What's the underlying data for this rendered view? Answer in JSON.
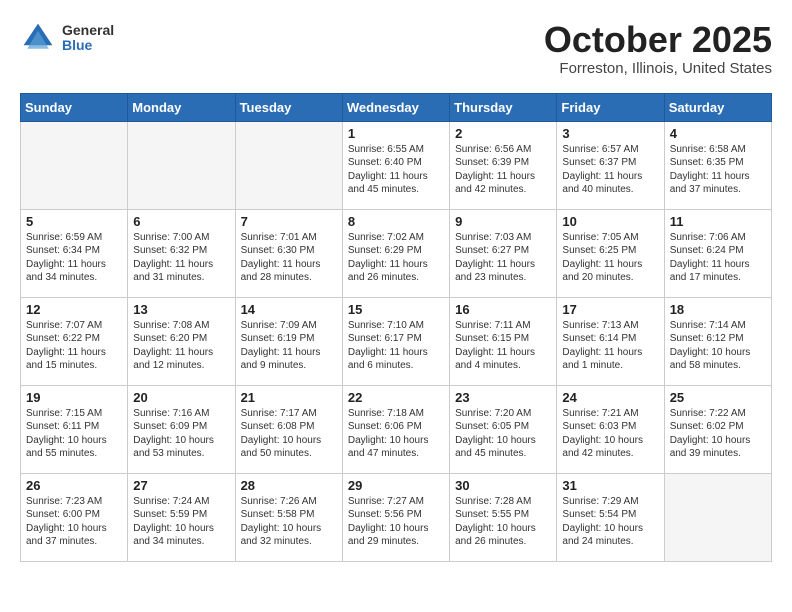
{
  "logo": {
    "general": "General",
    "blue": "Blue"
  },
  "title": "October 2025",
  "location": "Forreston, Illinois, United States",
  "weekdays": [
    "Sunday",
    "Monday",
    "Tuesday",
    "Wednesday",
    "Thursday",
    "Friday",
    "Saturday"
  ],
  "weeks": [
    [
      {
        "day": null
      },
      {
        "day": null
      },
      {
        "day": null
      },
      {
        "day": "1",
        "sunrise": "6:55 AM",
        "sunset": "6:40 PM",
        "daylight": "11 hours and 45 minutes."
      },
      {
        "day": "2",
        "sunrise": "6:56 AM",
        "sunset": "6:39 PM",
        "daylight": "11 hours and 42 minutes."
      },
      {
        "day": "3",
        "sunrise": "6:57 AM",
        "sunset": "6:37 PM",
        "daylight": "11 hours and 40 minutes."
      },
      {
        "day": "4",
        "sunrise": "6:58 AM",
        "sunset": "6:35 PM",
        "daylight": "11 hours and 37 minutes."
      }
    ],
    [
      {
        "day": "5",
        "sunrise": "6:59 AM",
        "sunset": "6:34 PM",
        "daylight": "11 hours and 34 minutes."
      },
      {
        "day": "6",
        "sunrise": "7:00 AM",
        "sunset": "6:32 PM",
        "daylight": "11 hours and 31 minutes."
      },
      {
        "day": "7",
        "sunrise": "7:01 AM",
        "sunset": "6:30 PM",
        "daylight": "11 hours and 28 minutes."
      },
      {
        "day": "8",
        "sunrise": "7:02 AM",
        "sunset": "6:29 PM",
        "daylight": "11 hours and 26 minutes."
      },
      {
        "day": "9",
        "sunrise": "7:03 AM",
        "sunset": "6:27 PM",
        "daylight": "11 hours and 23 minutes."
      },
      {
        "day": "10",
        "sunrise": "7:05 AM",
        "sunset": "6:25 PM",
        "daylight": "11 hours and 20 minutes."
      },
      {
        "day": "11",
        "sunrise": "7:06 AM",
        "sunset": "6:24 PM",
        "daylight": "11 hours and 17 minutes."
      }
    ],
    [
      {
        "day": "12",
        "sunrise": "7:07 AM",
        "sunset": "6:22 PM",
        "daylight": "11 hours and 15 minutes."
      },
      {
        "day": "13",
        "sunrise": "7:08 AM",
        "sunset": "6:20 PM",
        "daylight": "11 hours and 12 minutes."
      },
      {
        "day": "14",
        "sunrise": "7:09 AM",
        "sunset": "6:19 PM",
        "daylight": "11 hours and 9 minutes."
      },
      {
        "day": "15",
        "sunrise": "7:10 AM",
        "sunset": "6:17 PM",
        "daylight": "11 hours and 6 minutes."
      },
      {
        "day": "16",
        "sunrise": "7:11 AM",
        "sunset": "6:15 PM",
        "daylight": "11 hours and 4 minutes."
      },
      {
        "day": "17",
        "sunrise": "7:13 AM",
        "sunset": "6:14 PM",
        "daylight": "11 hours and 1 minute."
      },
      {
        "day": "18",
        "sunrise": "7:14 AM",
        "sunset": "6:12 PM",
        "daylight": "10 hours and 58 minutes."
      }
    ],
    [
      {
        "day": "19",
        "sunrise": "7:15 AM",
        "sunset": "6:11 PM",
        "daylight": "10 hours and 55 minutes."
      },
      {
        "day": "20",
        "sunrise": "7:16 AM",
        "sunset": "6:09 PM",
        "daylight": "10 hours and 53 minutes."
      },
      {
        "day": "21",
        "sunrise": "7:17 AM",
        "sunset": "6:08 PM",
        "daylight": "10 hours and 50 minutes."
      },
      {
        "day": "22",
        "sunrise": "7:18 AM",
        "sunset": "6:06 PM",
        "daylight": "10 hours and 47 minutes."
      },
      {
        "day": "23",
        "sunrise": "7:20 AM",
        "sunset": "6:05 PM",
        "daylight": "10 hours and 45 minutes."
      },
      {
        "day": "24",
        "sunrise": "7:21 AM",
        "sunset": "6:03 PM",
        "daylight": "10 hours and 42 minutes."
      },
      {
        "day": "25",
        "sunrise": "7:22 AM",
        "sunset": "6:02 PM",
        "daylight": "10 hours and 39 minutes."
      }
    ],
    [
      {
        "day": "26",
        "sunrise": "7:23 AM",
        "sunset": "6:00 PM",
        "daylight": "10 hours and 37 minutes."
      },
      {
        "day": "27",
        "sunrise": "7:24 AM",
        "sunset": "5:59 PM",
        "daylight": "10 hours and 34 minutes."
      },
      {
        "day": "28",
        "sunrise": "7:26 AM",
        "sunset": "5:58 PM",
        "daylight": "10 hours and 32 minutes."
      },
      {
        "day": "29",
        "sunrise": "7:27 AM",
        "sunset": "5:56 PM",
        "daylight": "10 hours and 29 minutes."
      },
      {
        "day": "30",
        "sunrise": "7:28 AM",
        "sunset": "5:55 PM",
        "daylight": "10 hours and 26 minutes."
      },
      {
        "day": "31",
        "sunrise": "7:29 AM",
        "sunset": "5:54 PM",
        "daylight": "10 hours and 24 minutes."
      },
      {
        "day": null
      }
    ]
  ]
}
